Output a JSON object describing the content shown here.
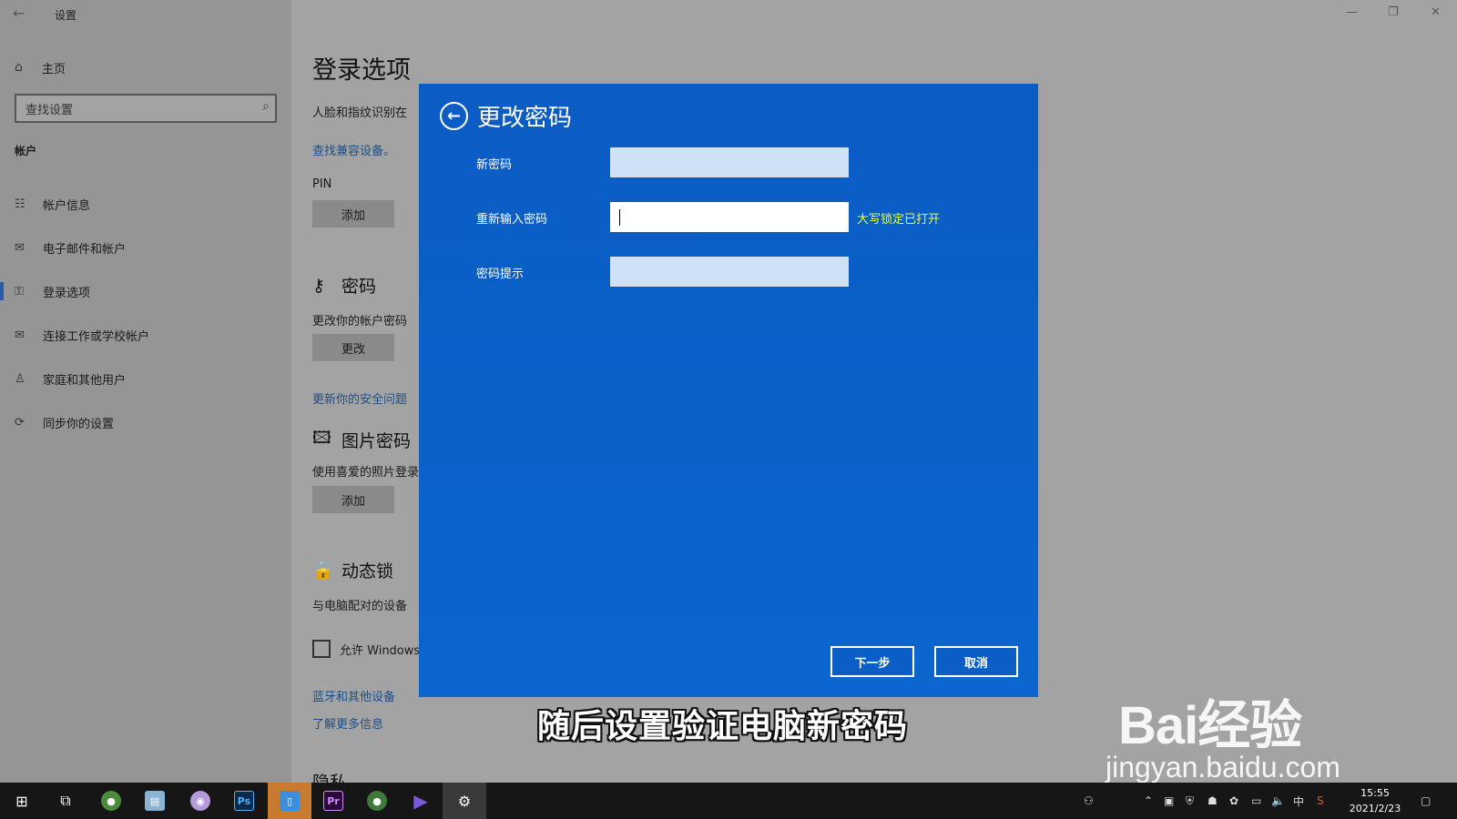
{
  "window": {
    "title": "设置",
    "home_label": "主页",
    "search_placeholder": "查找设置",
    "section_label": "帐户"
  },
  "sidebar": {
    "items": [
      {
        "label": "帐户信息",
        "icon": "account-info-icon"
      },
      {
        "label": "电子邮件和帐户",
        "icon": "mail-icon"
      },
      {
        "label": "登录选项",
        "icon": "key-icon"
      },
      {
        "label": "连接工作或学校帐户",
        "icon": "briefcase-icon"
      },
      {
        "label": "家庭和其他用户",
        "icon": "person-icon"
      },
      {
        "label": "同步你的设置",
        "icon": "sync-icon"
      }
    ],
    "active_index": 2
  },
  "content": {
    "title": "登录选项",
    "face_text": "人脸和指纹识别在",
    "find_devices_link": "查找兼容设备。",
    "pin_label": "PIN",
    "pin_add_button": "添加",
    "password_heading": "密码",
    "password_text": "更改你的帐户密码",
    "password_change_button": "更改",
    "security_link": "更新你的安全问题",
    "picture_heading": "图片密码",
    "picture_text": "使用喜爱的照片登录",
    "picture_add_button": "添加",
    "dynamic_heading": "动态锁",
    "dynamic_text": "与电脑配对的设备",
    "allow_checkbox_label": "允许 Windows",
    "bluetooth_link": "蓝牙和其他设备",
    "learn_more_link": "了解更多信息",
    "privacy_heading": "隐私"
  },
  "dialog": {
    "title": "更改密码",
    "new_password_label": "新密码",
    "confirm_password_label": "重新输入密码",
    "hint_label": "密码提示",
    "caps_lock_warning": "大写锁定已打开",
    "next_button": "下一步",
    "cancel_button": "取消",
    "accent": "#0a5ec6",
    "warning_color": "#e6ff3a"
  },
  "subtitle": "随后设置验证电脑新密码",
  "watermark": {
    "brand": "Bai经验",
    "url": "jingyan.baidu.com"
  },
  "taskbar": {
    "apps": [
      "start-icon",
      "task-view-icon",
      "chrome-icon",
      "notes-icon",
      "disk-icon",
      "photoshop-icon",
      "phone-icon",
      "premiere-icon",
      "chrome-icon",
      "media-icon",
      "settings-icon"
    ],
    "photoshop_label": "Ps",
    "premiere_label": "Pr",
    "ime_label": "中",
    "time": "15:55",
    "date": "2021/2/23"
  }
}
